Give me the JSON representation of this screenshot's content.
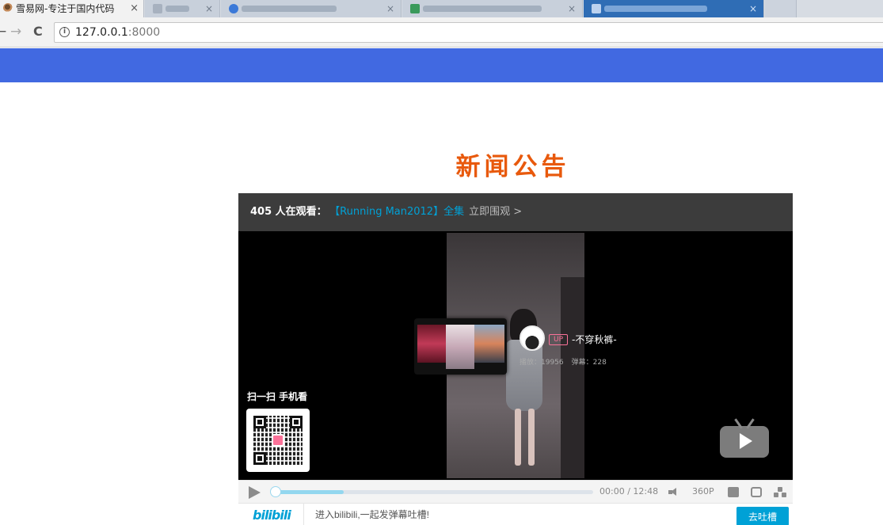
{
  "browser": {
    "active_tab_title": "雪易网-专注于国内代码",
    "active_tab_close": "×",
    "address": {
      "host": "127.0.0.1",
      "port": ":8000"
    },
    "nav": {
      "back": "←",
      "forward": "→",
      "reload": "C"
    }
  },
  "page": {
    "title": "新闻公告"
  },
  "player": {
    "watch_count": "405 人在观看：",
    "series_link": "【Running Man2012】全集",
    "watch_now": "立即围观 >",
    "up": {
      "badge": "UP",
      "name": "-不穿秋裤-",
      "plays": "播放：19956",
      "danmaku": "弹幕：228"
    },
    "qr_label": "扫一扫 手机看",
    "controls": {
      "time": "00:00 / 12:48",
      "quality": "360P",
      "buffered_fraction": 0.22
    },
    "danmaku_bar": {
      "logo": "bilibili",
      "placeholder": "进入bilibili,一起发弹幕吐槽!",
      "send": "去吐槽"
    }
  },
  "colors": {
    "header": "#4169e1",
    "title": "#e8590c",
    "bili_blue": "#00a1d6",
    "bili_pink": "#fb7299"
  }
}
